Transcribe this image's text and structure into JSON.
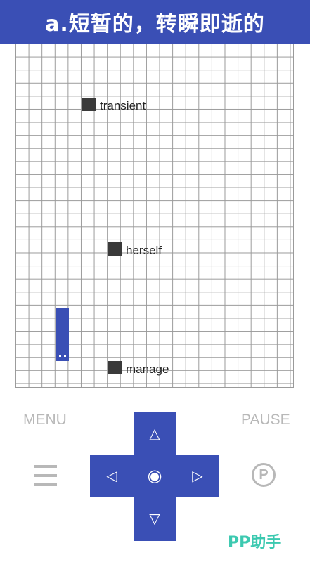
{
  "header": {
    "title": "a.短暂的，转瞬即逝的"
  },
  "words": [
    {
      "text": "transient"
    },
    {
      "text": "herself"
    },
    {
      "text": "manage"
    }
  ],
  "controls": {
    "menu_label": "MENU",
    "pause_label": "PAUSE",
    "pause_icon_glyph": "P",
    "up": "△",
    "down": "▽",
    "left": "◁",
    "right": "▷",
    "center": "◉"
  },
  "watermark": "PP助手",
  "colors": {
    "accent": "#3a4fb5",
    "block": "#3a3a3a",
    "control_gray": "#b8b8b8",
    "watermark": "#3cc9b0"
  }
}
